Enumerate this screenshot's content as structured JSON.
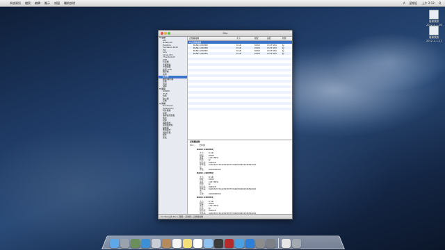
{
  "menubar": {
    "apple": "",
    "menus": [
      "系統資訊",
      "檔案",
      "編輯",
      "顯示",
      "視窗",
      "輔助說明"
    ],
    "status": [
      "A",
      "星期日",
      "上午 2:12",
      "Q"
    ]
  },
  "desktop_icons": [
    {
      "label": "螢幕快照",
      "label2": "2012-1..1.16",
      "color": "#e9eef5"
    },
    {
      "label": "螢幕快照",
      "label2": "2012-1..1.17",
      "color": "#e9eef5"
    }
  ],
  "window": {
    "title": "Mac",
    "sidebar": {
      "groups": [
        {
          "name": "硬體",
          "items": [
            "ATA",
            "Bluetooth",
            "FireWire",
            "Hardware RAID",
            "PCI",
            "SAS",
            "Serial-ATA",
            "Thunderbolt",
            "USB",
            "印表機",
            "光碟燒錄",
            "卡閱讀器",
            "並列 SCSI",
            "攝影機",
            "電源",
            "記憶體",
            "圖形/顯示器",
            "診斷",
            "音訊",
            "儲存"
          ]
        },
        {
          "name": "網路",
          "items": [
            "WWAN",
            "Wi-Fi",
            "位置",
            "防火牆",
            "宗卷"
          ]
        },
        {
          "name": "軟體",
          "items": [
            "Developer",
            "Extensions",
            "同步服務",
            "字體",
            "偏好設定面板",
            "框架",
            "記錄",
            "輔助程式",
            "停用的軟體",
            "描述檔",
            "應用程式",
            "通用存取",
            "組件",
            "安裝"
          ]
        }
      ],
      "selected": "記憶體"
    },
    "table": {
      "headers": [
        "記憶體插槽",
        "大小",
        "類型",
        "速度",
        "狀態"
      ],
      "group_row": "▼ 記憶體插槽",
      "rows": [
        [
          "BANK 0/DIMM0",
          "8 GB",
          "DDR3",
          "1333 MHz",
          "好"
        ],
        [
          "BANK 1/DIMM0",
          "8 GB",
          "DDR3",
          "1333 MHz",
          "好"
        ],
        [
          "BANK 0/DIMM1",
          "8 GB",
          "DDR3",
          "1333 MHz",
          "好"
        ],
        [
          "BANK 1/DIMM1",
          "8 GB",
          "DDR3",
          "1333 MHz",
          "好"
        ]
      ]
    },
    "detail": {
      "heading": "記憶體插槽：",
      "ecc_label": "ECC：",
      "ecc_value": "已停用",
      "banks": [
        {
          "name": "BANK 0/DIMM0：",
          "size": "8 GB",
          "type": "DDR3",
          "speed": "1333 MHz",
          "status": "好",
          "manufacturer": "0x80CE",
          "part": "0x4D34373142323837334448302D4348392020",
          "serial": "0x00000000"
        },
        {
          "name": "BANK 1/DIMM0：",
          "size": "8 GB",
          "type": "DDR3",
          "speed": "1333 MHz",
          "status": "好",
          "manufacturer": "0x80CE",
          "part": "0x4D34373142323837334448302D4348392020",
          "serial": "0x00000000"
        },
        {
          "name": "BANK 0/DIMM1：",
          "size": "8 GB",
          "type": "DDR3",
          "speed": "1333 MHz",
          "status": "好",
          "manufacturer": "0x80CE",
          "part": "0x4D34373142323837334448302D4348392020",
          "serial": "0x00000000"
        },
        {
          "name": "BANK 1/DIMM1：",
          "size": "8 GB",
          "type": "DDR3",
          "speed": "1333 MHz",
          "status": "好",
          "manufacturer": "0x80CE",
          "part": "0x4D34373142323837334448302D4348392020",
          "serial": "0x00000000"
        }
      ],
      "labels": {
        "size": "大小：",
        "type": "類型：",
        "speed": "速度：",
        "status": "狀態：",
        "manufacturer": "製造商：",
        "part": "零件編號：",
        "serial": "序號："
      }
    },
    "statusbar": "Xin Wang 的 Mac ▸ 硬體 ▸ 記憶體 ▸ 記憶體插槽"
  },
  "dock": {
    "icons": [
      {
        "name": "finder-icon",
        "color": "#5fa8e8"
      },
      {
        "name": "launchpad-icon",
        "color": "#9aa3ad"
      },
      {
        "name": "mission-control-icon",
        "color": "#6b8f5a"
      },
      {
        "name": "safari-icon",
        "color": "#3d8fd6"
      },
      {
        "name": "mail-icon",
        "color": "#c9ced6"
      },
      {
        "name": "contacts-icon",
        "color": "#b58a5c"
      },
      {
        "name": "calendar-icon",
        "color": "#f4f4f4"
      },
      {
        "name": "notes-icon",
        "color": "#f4e07a"
      },
      {
        "name": "reminders-icon",
        "color": "#ffffff"
      },
      {
        "name": "messages-icon",
        "color": "#8fc1ef"
      },
      {
        "name": "facetime-icon",
        "color": "#3a3a3a"
      },
      {
        "name": "photo-booth-icon",
        "color": "#b52b2b"
      },
      {
        "name": "itunes-icon",
        "color": "#4aa0e0"
      },
      {
        "name": "app-store-icon",
        "color": "#2f7fd6"
      },
      {
        "name": "system-preferences-icon",
        "color": "#8c8c8c"
      },
      {
        "name": "system-information-icon",
        "color": "#7c7f86"
      },
      {
        "name": "documents-stack-icon",
        "color": "#e6e6e6"
      },
      {
        "name": "trash-icon",
        "color": "#a3a9b1"
      }
    ]
  }
}
